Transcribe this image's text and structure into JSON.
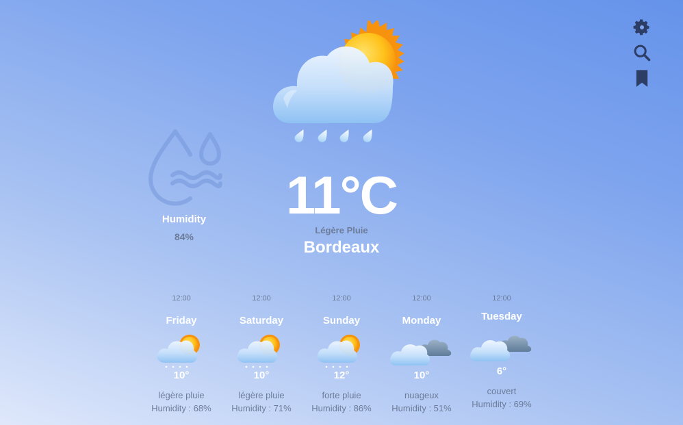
{
  "toolbar": {
    "icons": [
      "gear-icon",
      "search-icon",
      "bookmark-icon"
    ],
    "icon_color": "#2d3e66"
  },
  "current": {
    "icon": "sun-behind-rain-cloud-icon",
    "temperature": "11°C",
    "condition": "Légère Pluie",
    "city": "Bordeaux",
    "humidity_label": "Humidity",
    "humidity_value": "84%"
  },
  "forecast": [
    {
      "time": "12:00",
      "day": "Friday",
      "icon": "sun-cloud-rain-icon",
      "temp": "10°",
      "desc": "légère pluie",
      "humidity": "Humidity : 68%"
    },
    {
      "time": "12:00",
      "day": "Saturday",
      "icon": "sun-cloud-rain-icon",
      "temp": "10°",
      "desc": "légère pluie",
      "humidity": "Humidity : 71%"
    },
    {
      "time": "12:00",
      "day": "Sunday",
      "icon": "sun-cloud-rain-icon",
      "temp": "12°",
      "desc": "forte pluie",
      "humidity": "Humidity : 86%"
    },
    {
      "time": "12:00",
      "day": "Monday",
      "icon": "clouds-icon",
      "temp": "10°",
      "desc": "nuageux",
      "humidity": "Humidity : 51%"
    },
    {
      "time": "12:00",
      "day": "Tuesday",
      "icon": "clouds-icon",
      "temp": "6°",
      "desc": "couvert",
      "humidity": "Humidity : 69%"
    }
  ],
  "colors": {
    "background_top": "#6593ea",
    "background_bottom": "#dfe8fb",
    "primary_text": "#ffffff",
    "secondary_text": "#6c7c99"
  }
}
